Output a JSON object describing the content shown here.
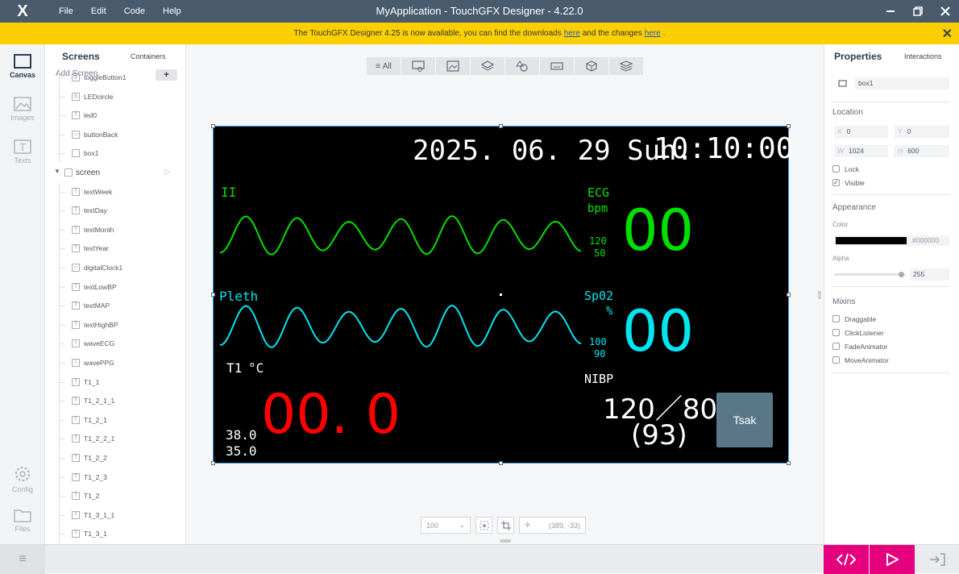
{
  "titlebar": {
    "logo": "X",
    "menu": [
      "File",
      "Edit",
      "Code",
      "Help"
    ],
    "title": "MyApplication - TouchGFX Designer - 4.22.0",
    "controls": [
      "minimize-icon",
      "restore-icon",
      "close-icon"
    ]
  },
  "banner": {
    "text_before": "The TouchGFX Designer 4.25 is now available, you can find the downloads",
    "link1": "here",
    "text_mid": "and the changes",
    "link2": "here",
    "text_after": "."
  },
  "leftbar": {
    "items": [
      {
        "label": "Canvas",
        "icon": "canvas-icon",
        "active": true
      },
      {
        "label": "Images",
        "icon": "image-icon",
        "active": false
      },
      {
        "label": "Texts",
        "icon": "text-icon",
        "active": false
      },
      {
        "label": "Config",
        "icon": "gear-icon",
        "active": false
      },
      {
        "label": "Files",
        "icon": "folder-icon",
        "active": false
      }
    ]
  },
  "tree": {
    "tab_screens": "Screens",
    "tab_containers": "Containers",
    "add_screen": "Add Screen",
    "add_button": "+",
    "items": [
      {
        "label": "toggleButton1",
        "type": "widget"
      },
      {
        "label": "LEDcircle",
        "type": "widget"
      },
      {
        "label": "led0",
        "type": "text"
      },
      {
        "label": "buttonBack",
        "type": "button"
      },
      {
        "label": "box1",
        "type": "box"
      },
      {
        "label": "screen",
        "type": "screen"
      },
      {
        "label": "textWeek",
        "type": "text"
      },
      {
        "label": "textDay",
        "type": "text"
      },
      {
        "label": "textMonth",
        "type": "text"
      },
      {
        "label": "textYear",
        "type": "text"
      },
      {
        "label": "digitalClock1",
        "type": "clock"
      },
      {
        "label": "textLowBP",
        "type": "text"
      },
      {
        "label": "textMAP",
        "type": "text"
      },
      {
        "label": "textHighBP",
        "type": "text"
      },
      {
        "label": "waveECG",
        "type": "graph"
      },
      {
        "label": "wavePPG",
        "type": "graph"
      },
      {
        "label": "T1_1",
        "type": "text"
      },
      {
        "label": "T1_2_1_1",
        "type": "text"
      },
      {
        "label": "T1_2_1",
        "type": "text"
      },
      {
        "label": "T1_2_2_1",
        "type": "text"
      },
      {
        "label": "T1_2_2",
        "type": "text"
      },
      {
        "label": "T1_2_3",
        "type": "text"
      },
      {
        "label": "T1_2",
        "type": "text"
      },
      {
        "label": "T1_3_1_1",
        "type": "text"
      },
      {
        "label": "T1_3_1",
        "type": "text"
      }
    ]
  },
  "toolbar": {
    "all_label": "All",
    "filters": [
      "interaction-icon",
      "image-icon",
      "layers-icon",
      "shapes-icon",
      "keyboard-icon",
      "cube-icon",
      "stack-icon"
    ]
  },
  "monitor": {
    "date": "2025. 06. 29 Sun.",
    "time": "10:10:00",
    "ecg_lead": "II",
    "ecg_label": "ECG",
    "ecg_unit": "bpm",
    "ecg_high": "120",
    "ecg_low": "50",
    "ecg_value": "00",
    "pleth_label": "Pleth",
    "spo2_label": "Sp02",
    "spo2_unit": "%",
    "spo2_high": "100",
    "spo2_low": "90",
    "spo2_value": "00",
    "temp_label": "T1",
    "temp_unit": "°C",
    "temp_value": "00. 0",
    "temp_high": "38.0",
    "temp_low": "35.0",
    "nibp_label": "NIBP",
    "nibp_value": "120／80",
    "nibp_map": "(93)",
    "button": "Tsak",
    "colors": {
      "ecg": "#00e000",
      "spo2": "#00e5f0",
      "temp": "#ff0000",
      "text": "#ffffff"
    }
  },
  "zoombar": {
    "zoom": "100",
    "coords": "(389, -33)"
  },
  "properties": {
    "tab_properties": "Properties",
    "tab_interactions": "Interactions",
    "name": "box1",
    "location_header": "Location",
    "x_key": "X",
    "x": "0",
    "y_key": "Y",
    "y": "0",
    "w_key": "W",
    "w": "1024",
    "h_key": "H",
    "h": "600",
    "lock_label": "Lock",
    "lock_checked": false,
    "visible_label": "Visible",
    "visible_checked": true,
    "appearance_header": "Appearance",
    "color_label": "Color",
    "color_value": "#000000",
    "alpha_label": "Alpha",
    "alpha_value": "255",
    "mixins_header": "Mixins",
    "mixins": [
      "Draggable",
      "ClickListener",
      "FadeAnimator",
      "MoveAnimator"
    ]
  },
  "bottombar": {
    "generate_icon": "code-icon",
    "run_icon": "play-icon",
    "export_icon": "export-icon"
  }
}
